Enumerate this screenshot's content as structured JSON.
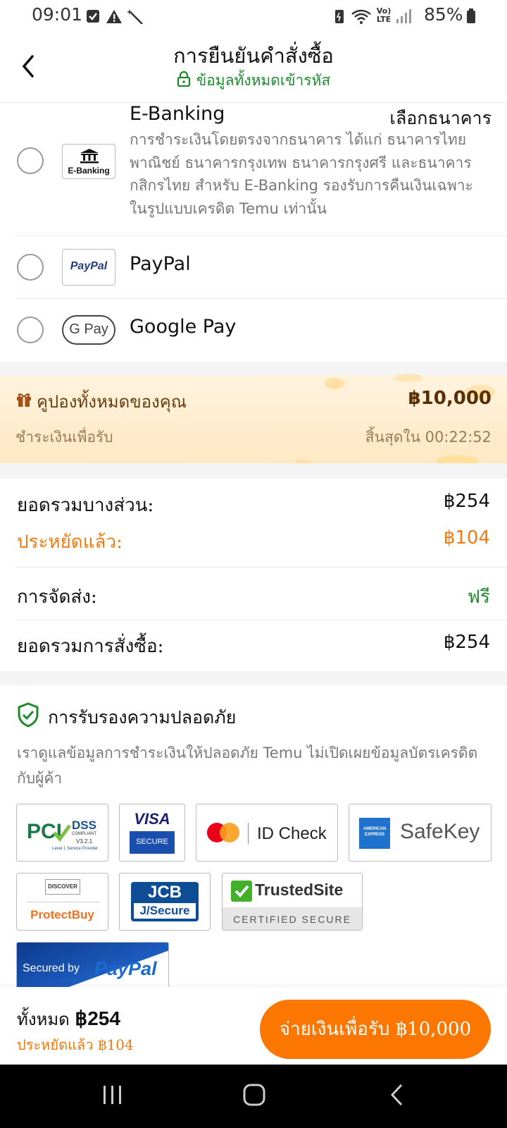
{
  "status_bar": {
    "time": "09:01",
    "battery": "85%",
    "network": "Vo) LTE"
  },
  "header": {
    "title": "การยืนยันคำสั่งซื้อ",
    "subtitle": "ข้อมูลทั้งหมดเข้ารหัส"
  },
  "payment_methods": [
    {
      "name": "E-Banking",
      "logo_text": "E-Banking",
      "action": "เลือกธนาคาร",
      "description": "การชำระเงินโดยตรงจากธนาคาร ได้แก่ ธนาคารไทยพาณิชย์ ธนาคารกรุงเทพ ธนาคารกรุงศรี และธนาคารกสิกรไทย สำหรับ E-Banking รองรับการคืนเงินเฉพาะในรูปแบบเครดิต Temu เท่านั้น"
    },
    {
      "name": "PayPal",
      "logo_text": "PayPal"
    },
    {
      "name": "Google Pay",
      "logo_text": "G Pay"
    }
  ],
  "coupon": {
    "title": "คูปองทั้งหมดของคุณ",
    "amount": "฿10,000",
    "subtitle": "ชำระเงินเพื่อรับ",
    "expiry": "สิ้นสุดใน 00:22:52"
  },
  "summary": {
    "subtotal_label": "ยอดรวมบางส่วน:",
    "subtotal_value": "฿254",
    "saved_label": "ประหยัดแล้ว:",
    "saved_value": "฿104",
    "shipping_label": "การจัดส่ง:",
    "shipping_value": "ฟรี",
    "total_label": "ยอดรวมการสั่งซื้อ:",
    "total_value": "฿254"
  },
  "security": {
    "title": "การรับรองความปลอดภัย",
    "description": "เราดูแลข้อมูลการชำระเงินให้ปลอดภัย Temu ไม่เปิดเผยข้อมูลบัตรเครดิตกับผู้ค้า",
    "badges": {
      "pci": {
        "main": "PCI",
        "dss": "DSS",
        "compliant": "COMPLIANT",
        "version": "V3.2.1",
        "note": "Level 1 Service Provider"
      },
      "visa": {
        "main": "VISA",
        "sub": "SECURE"
      },
      "mastercard": "ID Check",
      "amex": {
        "logo": "AMERICAN EXPRESS",
        "text": "SafeKey"
      },
      "discover": {
        "logo": "DISCOVER",
        "text": "ProtectBuy"
      },
      "jcb": {
        "main": "JCB",
        "sub": "J/Secure"
      },
      "trustedsite": {
        "main": "TrustedSite",
        "sub": "CERTIFIED SECURE"
      },
      "paypal": {
        "prefix": "Secured by",
        "brand": "PayPal"
      }
    }
  },
  "bottom_bar": {
    "total_label": "ทั้งหมด",
    "total_value": "฿254",
    "saved": "ประหยัดแล้ว ฿104",
    "pay_button": "จ่ายเงินเพื่อรับ ฿10,000"
  },
  "colors": {
    "accent_orange": "#fb7701",
    "secure_green": "#1e8a2e",
    "coupon_brown": "#6b3b0d"
  }
}
